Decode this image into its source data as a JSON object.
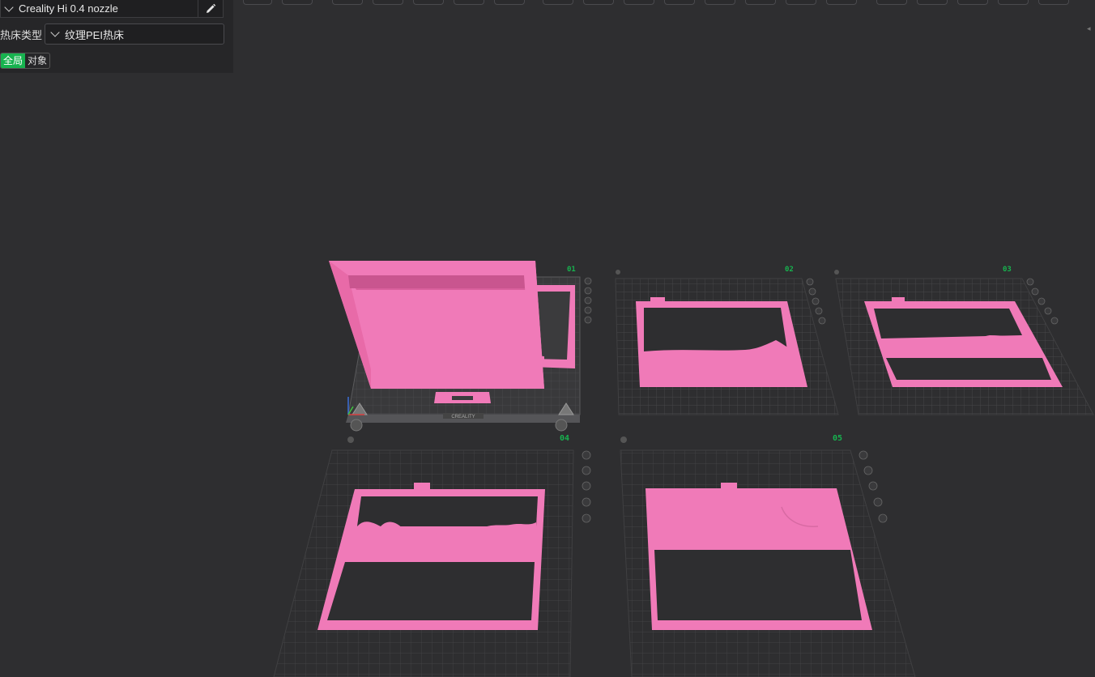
{
  "left_panel": {
    "printer": "Creality Hi 0.4 nozzle",
    "bed_type_label": "热床类型",
    "bed_type_value": "纹理PEI热床",
    "scope_tabs": [
      "全局",
      "对象"
    ]
  },
  "toolbar": {
    "icons": [
      "orient-icon",
      "add-icon",
      "separator",
      "move-icon",
      "rotate-icon",
      "place-face-icon",
      "cut-icon",
      "arrange-icon",
      "split-icon",
      "layout-icon",
      "scale-icon",
      "mirror-icon",
      "support-icon",
      "seam-icon",
      "color-icon",
      "text-icon",
      "measure-icon",
      "assembly-icon",
      "view-icon",
      "plate-icon"
    ]
  },
  "plates": [
    {
      "number": "01"
    },
    {
      "number": "02"
    },
    {
      "number": "03"
    },
    {
      "number": "04"
    },
    {
      "number": "05"
    }
  ],
  "bed_brand": "CREALITY",
  "colors": {
    "background": "#2e2e30",
    "panel": "#262628",
    "model_pink": "#f07ab8",
    "accent_green": "#17b34f",
    "grid": "#4a4a4c"
  }
}
